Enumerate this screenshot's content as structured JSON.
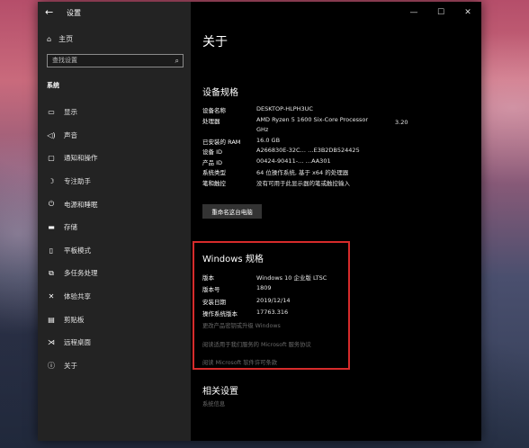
{
  "window": {
    "title": "设置",
    "back_icon": "arrow-left-icon"
  },
  "controls": {
    "minimize": "—",
    "maximize": "☐",
    "close": "✕"
  },
  "sidebar": {
    "home_label": "主页",
    "search_placeholder": "查找设置",
    "section": "系统",
    "items": [
      {
        "label": "显示",
        "icon": "monitor-icon"
      },
      {
        "label": "声音",
        "icon": "speaker-icon"
      },
      {
        "label": "通知和操作",
        "icon": "message-icon"
      },
      {
        "label": "专注助手",
        "icon": "moon-icon"
      },
      {
        "label": "电源和睡眠",
        "icon": "power-icon"
      },
      {
        "label": "存储",
        "icon": "drive-icon"
      },
      {
        "label": "平板模式",
        "icon": "tablet-icon"
      },
      {
        "label": "多任务处理",
        "icon": "multitask-icon"
      },
      {
        "label": "体验共享",
        "icon": "share-icon"
      },
      {
        "label": "剪贴板",
        "icon": "clipboard-icon"
      },
      {
        "label": "远程桌面",
        "icon": "remote-icon"
      },
      {
        "label": "关于",
        "icon": "info-icon"
      }
    ]
  },
  "main": {
    "title": "关于",
    "device_specs": {
      "heading": "设备规格",
      "rows": [
        {
          "key": "设备名称",
          "value": "DESKTOP-HLPH3UC"
        },
        {
          "key": "处理器",
          "value": "AMD Ryzen 5 1600 Six-Core Processor"
        },
        {
          "key": "",
          "value": "GHz"
        },
        {
          "key": "已安装的 RAM",
          "value": "16.0 GB"
        },
        {
          "key": "设备 ID",
          "value": "A266830E-32C… …E3B2DB524425"
        },
        {
          "key": "产品 ID",
          "value": "00424-90411-… …AA301"
        },
        {
          "key": "系统类型",
          "value": "64 位操作系统, 基于 x64 的处理器"
        },
        {
          "key": "笔和触控",
          "value": "没有可用于此显示器的笔或触控输入"
        }
      ],
      "cpu_speed": "3.20",
      "rename_button": "重命名这台电脑"
    },
    "windows_specs": {
      "heading": "Windows 规格",
      "rows": [
        {
          "key": "版本",
          "value": "Windows 10 企业版 LTSC"
        },
        {
          "key": "版本号",
          "value": "1809"
        },
        {
          "key": "安装日期",
          "value": "2019/12/14"
        },
        {
          "key": "操作系统版本",
          "value": "17763.316"
        }
      ],
      "links": [
        "更改产品密钥或升级 Windows",
        "阅读适用于我们服务的 Microsoft 服务协议",
        "阅读 Microsoft 软件许可条款"
      ]
    },
    "related": {
      "heading": "相关设置",
      "link": "系统信息"
    }
  }
}
